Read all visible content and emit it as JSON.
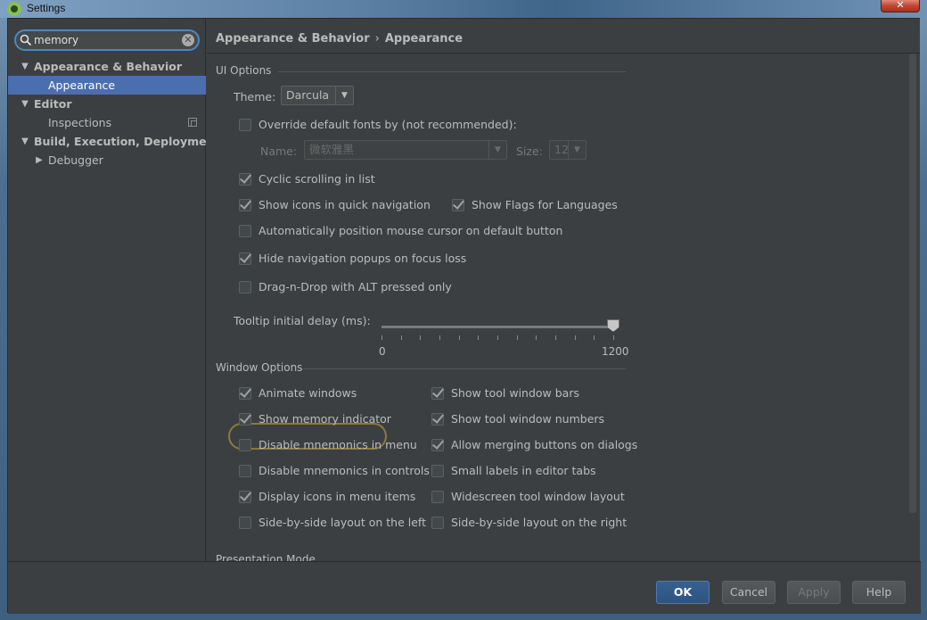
{
  "window": {
    "title": "Settings",
    "close_glyph": "✕"
  },
  "sidebar": {
    "search": {
      "value": "memory",
      "clear_glyph": "✕"
    },
    "tree": [
      {
        "label": "Appearance & Behavior",
        "level": 0,
        "expanded": true,
        "bold": true
      },
      {
        "label": "Appearance",
        "level": 1,
        "selected": true
      },
      {
        "label": "Editor",
        "level": 0,
        "expanded": true,
        "bold": true
      },
      {
        "label": "Inspections",
        "level": 1,
        "icon": "copy-icon"
      },
      {
        "label": "Build, Execution, Deployment",
        "level": 0,
        "expanded": true,
        "bold": true
      },
      {
        "label": "Debugger",
        "level": 1,
        "collapsed": true
      }
    ]
  },
  "breadcrumb": {
    "parent": "Appearance & Behavior",
    "separator": "›",
    "current": "Appearance"
  },
  "ui_options": {
    "title": "UI Options",
    "theme_label": "Theme:",
    "theme_value": "Darcula",
    "override_fonts": {
      "label": "Override default fonts by (not recommended):",
      "checked": false
    },
    "name_label": "Name:",
    "name_value": "微软雅黑",
    "size_label": "Size:",
    "size_value": "12",
    "cyclic_scrolling": {
      "label": "Cyclic scrolling in list",
      "checked": true
    },
    "show_icons_nav": {
      "label": "Show icons in quick navigation",
      "checked": true
    },
    "show_flags": {
      "label": "Show Flags for Languages",
      "checked": true
    },
    "auto_position_mouse": {
      "label": "Automatically position mouse cursor on default button",
      "checked": false
    },
    "hide_nav_popups": {
      "label": "Hide navigation popups on focus loss",
      "checked": true
    },
    "drag_drop_alt": {
      "label": "Drag-n-Drop with ALT pressed only",
      "checked": false
    },
    "tooltip_label": "Tooltip initial delay (ms):",
    "tooltip_min": "0",
    "tooltip_max": "1200",
    "tooltip_value": 1200
  },
  "window_options": {
    "title": "Window Options",
    "left": [
      {
        "label": "Animate windows",
        "checked": true
      },
      {
        "label": "Show memory indicator",
        "checked": true
      },
      {
        "label": "Disable mnemonics in menu",
        "checked": false
      },
      {
        "label": "Disable mnemonics in controls",
        "checked": false
      },
      {
        "label": "Display icons in menu items",
        "checked": true
      },
      {
        "label": "Side-by-side layout on the left",
        "checked": false
      }
    ],
    "right": [
      {
        "label": "Show tool window bars",
        "checked": true
      },
      {
        "label": "Show tool window numbers",
        "checked": true
      },
      {
        "label": "Allow merging buttons on dialogs",
        "checked": true
      },
      {
        "label": "Small labels in editor tabs",
        "checked": false
      },
      {
        "label": "Widescreen tool window layout",
        "checked": false
      },
      {
        "label": "Side-by-side layout on the right",
        "checked": false
      }
    ]
  },
  "presentation_mode": {
    "title": "Presentation Mode"
  },
  "buttons": {
    "ok": "OK",
    "cancel": "Cancel",
    "apply": "Apply",
    "help": "Help"
  }
}
